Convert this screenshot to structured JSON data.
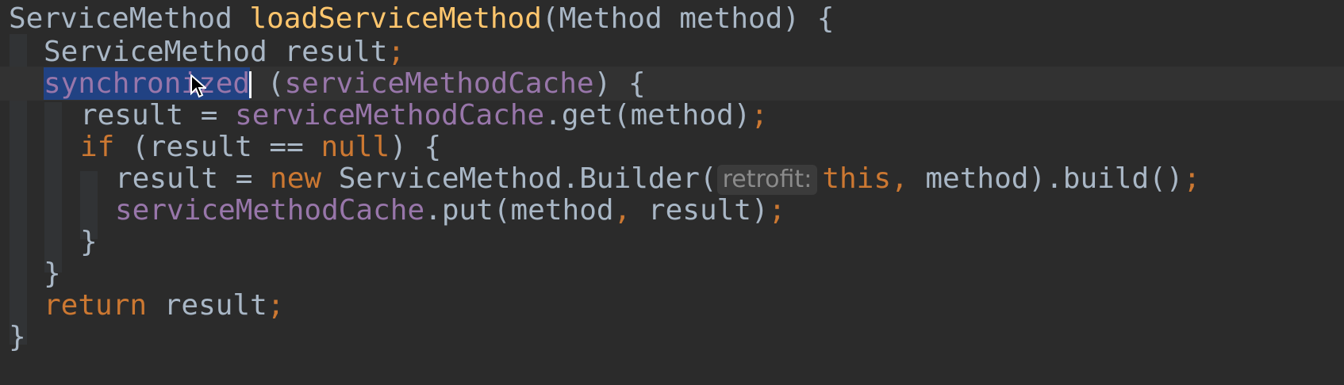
{
  "editor": {
    "lines": [
      {
        "tokens": [
          {
            "text": "ServiceMethod ",
            "style": "plain"
          },
          {
            "text": "loadServiceMethod",
            "style": "fn"
          },
          {
            "text": "(Method method) {",
            "style": "plain"
          }
        ]
      },
      {
        "tokens": [
          {
            "text": "ServiceMethod result",
            "style": "plain"
          },
          {
            "text": ";",
            "style": "kw"
          }
        ]
      },
      {
        "tokens": [
          {
            "text": "synchronized",
            "style": "selected-kw"
          },
          {
            "text": "",
            "style": "caret"
          },
          {
            "text": " (",
            "style": "plain"
          },
          {
            "text": "serviceMethodCache",
            "style": "field"
          },
          {
            "text": ") {",
            "style": "plain"
          }
        ]
      },
      {
        "tokens": [
          {
            "text": "result = ",
            "style": "plain"
          },
          {
            "text": "serviceMethodCache",
            "style": "field"
          },
          {
            "text": ".get(method)",
            "style": "plain"
          },
          {
            "text": ";",
            "style": "kw"
          }
        ]
      },
      {
        "tokens": [
          {
            "text": "if ",
            "style": "kw"
          },
          {
            "text": "(result == ",
            "style": "plain"
          },
          {
            "text": "null",
            "style": "kw"
          },
          {
            "text": ") {",
            "style": "plain"
          }
        ]
      },
      {
        "tokens": [
          {
            "text": "result = ",
            "style": "plain"
          },
          {
            "text": "new ",
            "style": "kw"
          },
          {
            "text": "ServiceMethod.Builder(",
            "style": "plain"
          },
          {
            "text": "retrofit:",
            "style": "hint"
          },
          {
            "text": "this",
            "style": "kw"
          },
          {
            "text": ", ",
            "style": "kw"
          },
          {
            "text": "method).build()",
            "style": "plain"
          },
          {
            "text": ";",
            "style": "kw"
          }
        ]
      },
      {
        "tokens": [
          {
            "text": "serviceMethodCache",
            "style": "field"
          },
          {
            "text": ".put(method",
            "style": "plain"
          },
          {
            "text": ", ",
            "style": "kw"
          },
          {
            "text": "result)",
            "style": "plain"
          },
          {
            "text": ";",
            "style": "kw"
          }
        ]
      },
      {
        "tokens": [
          {
            "text": "}",
            "style": "plain"
          }
        ]
      },
      {
        "tokens": [
          {
            "text": "}",
            "style": "plain"
          }
        ]
      },
      {
        "tokens": [
          {
            "text": "return ",
            "style": "kw"
          },
          {
            "text": "result",
            "style": "plain"
          },
          {
            "text": ";",
            "style": "kw"
          }
        ]
      },
      {
        "tokens": [
          {
            "text": "}",
            "style": "plain"
          }
        ]
      }
    ],
    "colors": {
      "background": "#2b2b2b",
      "current_line": "#323232",
      "selection": "#214283",
      "plain": "#a9b7c6",
      "keyword": "#cc7832",
      "method_declaration": "#ffc66d",
      "field": "#9876aa",
      "parameter_hint": "#8b8b8b"
    },
    "mouse_cursor": "arrow-pointer-icon"
  }
}
